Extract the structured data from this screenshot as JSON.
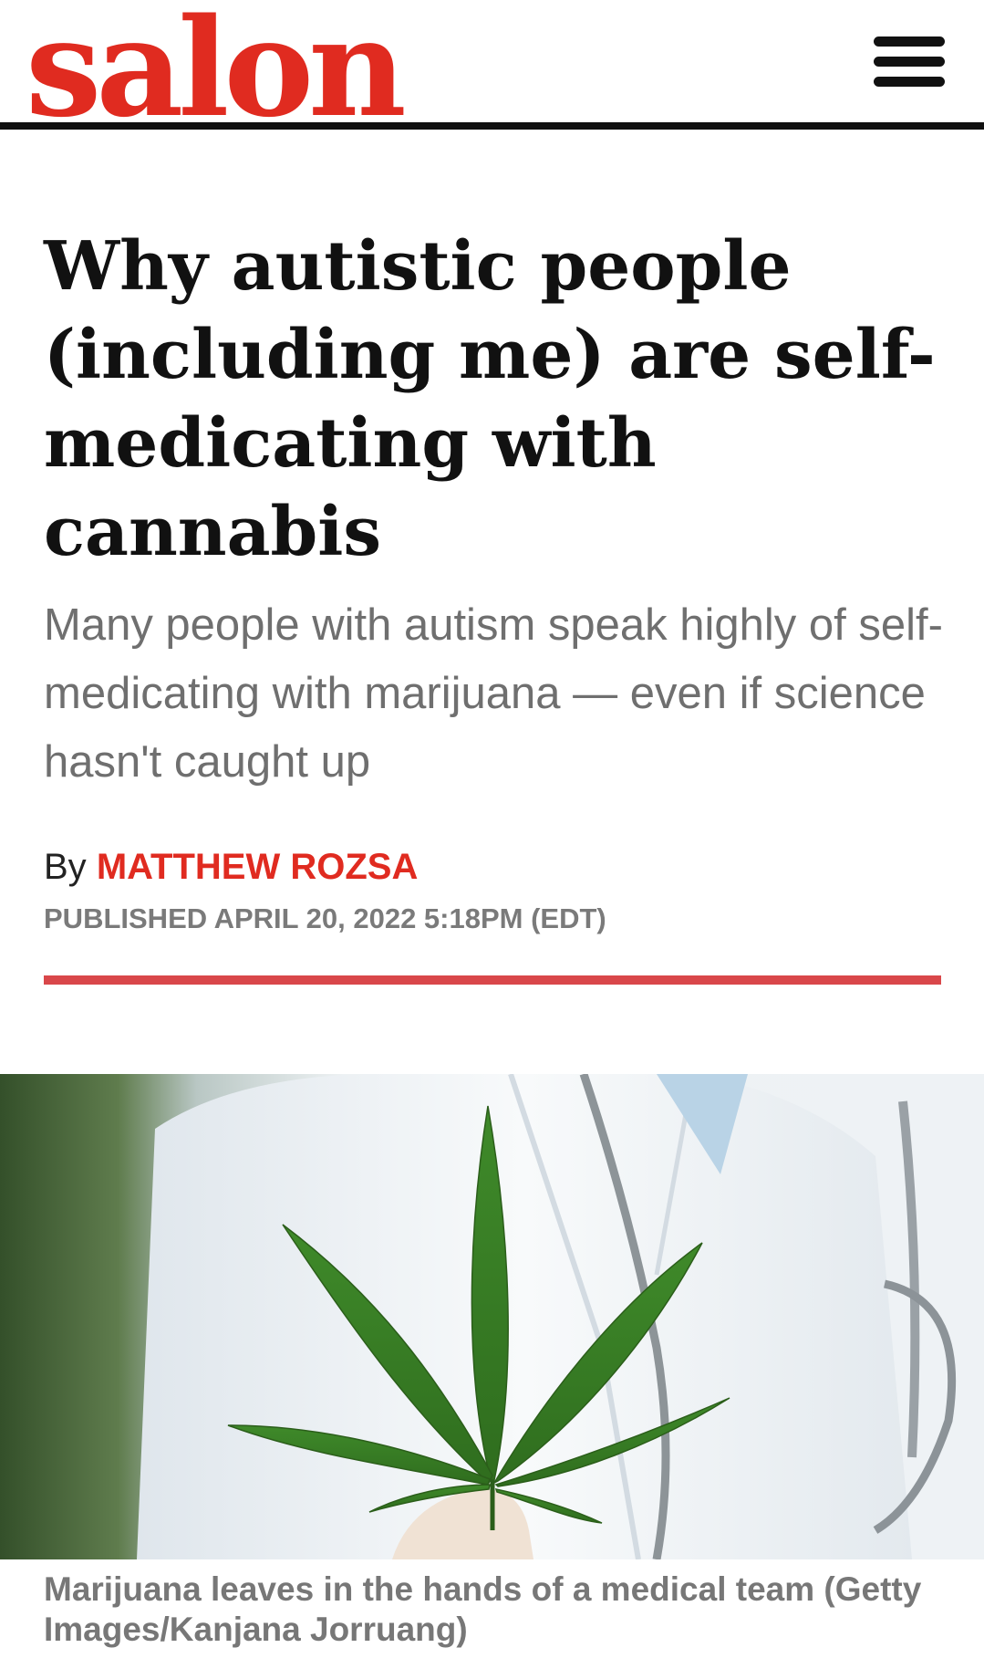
{
  "header": {
    "logo_text": "salon",
    "menu_icon": "hamburger-menu-icon",
    "brand_color": "#e02b20"
  },
  "article": {
    "headline": "Why autistic people (including me) are self-medicating with cannabis",
    "dek": "Many people with autism speak highly of self-medicating with marijuana — even if science hasn't caught up",
    "byline_prefix": "By",
    "author": "MATTHEW ROZSA",
    "published": "PUBLISHED APRIL 20, 2022 5:18PM (EDT)",
    "accent_rule_color": "#d9474a"
  },
  "hero_image": {
    "caption": "Marijuana leaves in the hands of a medical team (Getty Images/Kanjana Jorruang)"
  }
}
